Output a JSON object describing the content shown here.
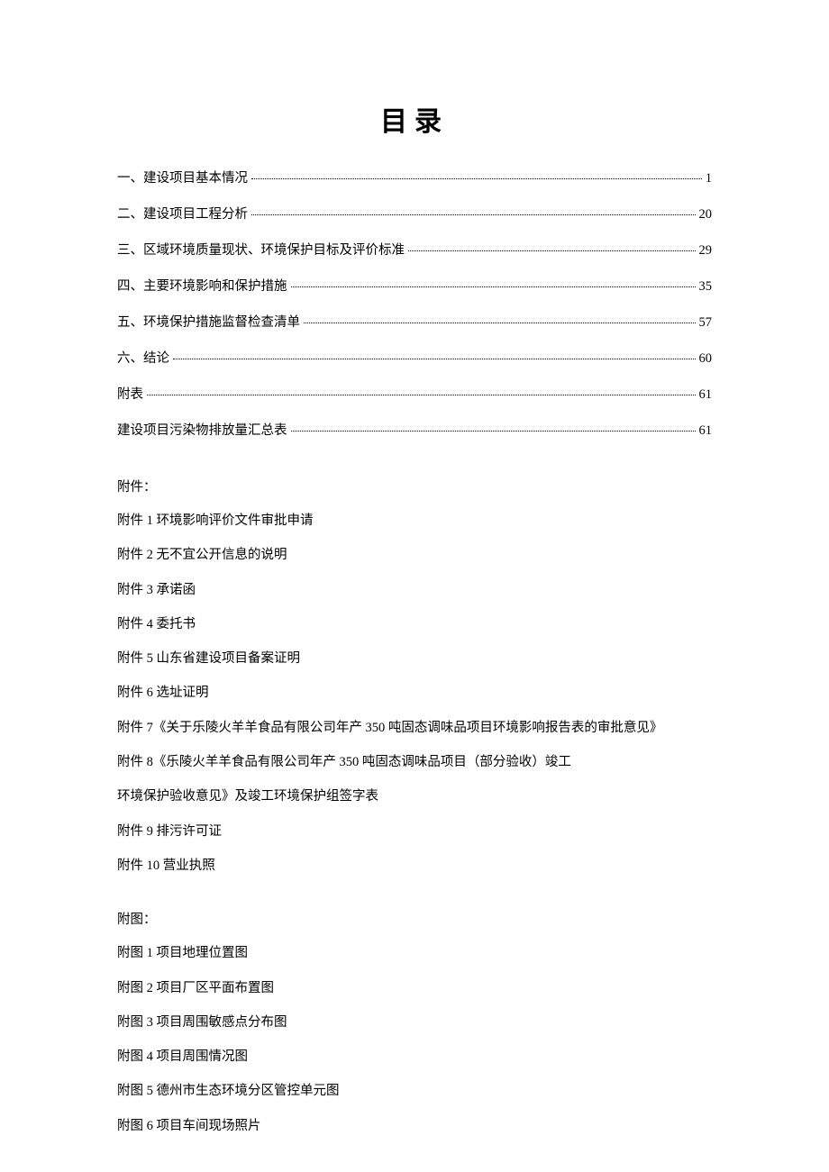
{
  "title": "目录",
  "toc": [
    {
      "label": "一、建设项目基本情况",
      "page": "1"
    },
    {
      "label": "二、建设项目工程分析",
      "page": "20"
    },
    {
      "label": "三、区域环境质量现状、环境保护目标及评价标准",
      "page": "29"
    },
    {
      "label": "四、主要环境影响和保护措施",
      "page": "35"
    },
    {
      "label": "五、环境保护措施监督检查清单",
      "page": "57"
    },
    {
      "label": "六、结论",
      "page": "60"
    },
    {
      "label": "附表",
      "page": "61"
    },
    {
      "label": "建设项目污染物排放量汇总表",
      "page": "61"
    }
  ],
  "attachments": {
    "heading": "附件：",
    "items": [
      "附件 1 环境影响评价文件审批申请",
      "附件 2 无不宜公开信息的说明",
      "附件 3 承诺函",
      "附件 4 委托书",
      "附件 5 山东省建设项目备案证明",
      "附件 6 选址证明",
      "附件 7《关于乐陵火羊羊食品有限公司年产 350 吨固态调味品项目环境影响报告表的审批意见》",
      "附件 8《乐陵火羊羊食品有限公司年产 350 吨固态调味品项目（部分验收）竣工",
      "环境保护验收意见》及竣工环境保护组签字表",
      "附件 9 排污许可证",
      "附件 10 营业执照"
    ]
  },
  "figures": {
    "heading": "附图：",
    "items": [
      "附图 1 项目地理位置图",
      "附图 2 项目厂区平面布置图",
      "附图 3 项目周围敏感点分布图",
      "附图 4 项目周围情况图",
      "附图 5 德州市生态环境分区管控单元图",
      "附图 6 项目车间现场照片"
    ]
  }
}
